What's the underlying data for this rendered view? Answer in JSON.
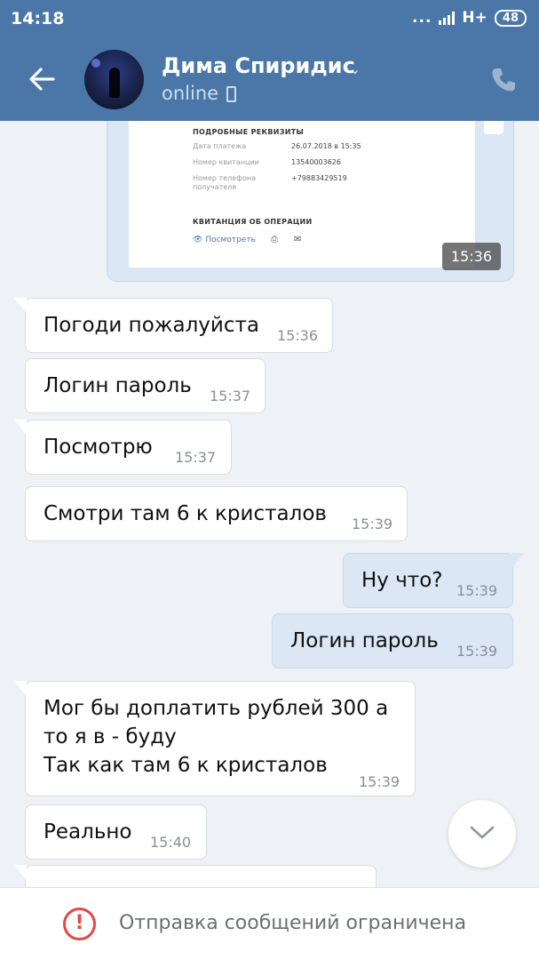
{
  "status_bar": {
    "time": "14:18",
    "dots": "...",
    "network": "H+",
    "battery": "48"
  },
  "header": {
    "contact_name": "Дима Спиридис",
    "chevron": "⌄",
    "status": "online",
    "icons": [
      "back-arrow-icon",
      "chevron-down-icon",
      "mobile-phone-icon",
      "call-icon"
    ]
  },
  "receipt": {
    "heading": "ПОДРОБНЫЕ РЕКВИЗИТЫ",
    "rows": [
      {
        "label": "Дата платежа",
        "value": "26.07.2018 в 15:35"
      },
      {
        "label": "Номер квитанции",
        "value": "13540003626"
      },
      {
        "label": "Номер телефона получателя",
        "value": "+79883429519"
      }
    ],
    "heading2": "КВИТАНЦИЯ ОБ ОПЕРАЦИИ",
    "view_link": "Посмотреть",
    "time": "15:36"
  },
  "messages": [
    {
      "direction": "in",
      "text": "Погоди пожалуйста",
      "time": "15:36"
    },
    {
      "direction": "in",
      "text": "Логин пароль",
      "time": "15:37"
    },
    {
      "direction": "in",
      "text": "Посмотрю",
      "time": "15:37"
    },
    {
      "direction": "in",
      "text": "Смотри там 6 к кристалов",
      "time": "15:39"
    },
    {
      "direction": "out",
      "text": "Ну что?",
      "time": "15:39"
    },
    {
      "direction": "out",
      "text": "Логин пароль",
      "time": "15:39"
    },
    {
      "direction": "in",
      "text": "Мог бы доплатить рублей 300 а\nто я в - буду\nТак как там 6 к кристалов",
      "time": "15:39"
    },
    {
      "direction": "in",
      "text": "Реально",
      "time": "15:40"
    }
  ],
  "bottom_bar": {
    "icon": "!",
    "text": "Отправка сообщений ограничена"
  },
  "colors": {
    "accent": "#4a76a8",
    "outgoing_bubble": "#dbe7f5",
    "background": "#eef1f5",
    "warning": "#e64646"
  }
}
